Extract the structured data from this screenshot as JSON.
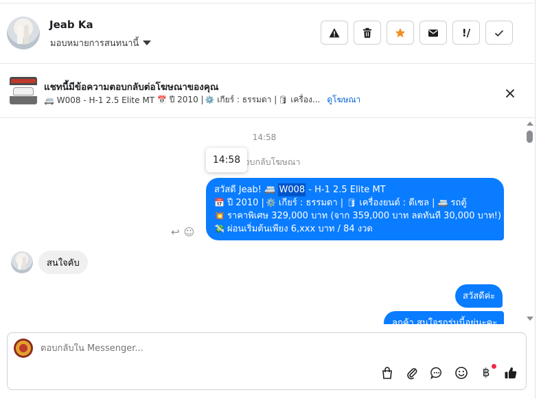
{
  "header": {
    "name": "Jeab Ka",
    "assign_label": "มอบหมายการสนทนานี้",
    "actions": [
      "warning-icon",
      "trash-icon",
      "star-icon",
      "mail-icon",
      "follow-up-icon",
      "check-icon"
    ],
    "star_color": "#f28c28"
  },
  "ad": {
    "title": "แชทนี้มีข้อความตอบกลับต่อโฆษณาของคุณ",
    "subtitle_prefix": "🚐 W008 - H-1 2.5 Elite MT",
    "subtitle_year": "ปี 2010 |",
    "subtitle_rest": "เกียร์ : ธรรมดา |",
    "subtitle_trunc": "เครื่อง...",
    "link": "ดูโฆษณา"
  },
  "chat": {
    "timestamp": "14:58",
    "tooltip_time": "14:58",
    "reply_note": "อบกลับโฆษณา",
    "ad_message": {
      "l1_a": "สวัสดี Jeab! 🚐 ",
      "l1_hl": "W008",
      "l1_b": " - H-1 2.5 Elite MT",
      "l2": "ปี 2010 |",
      "l2_b": "เกียร์ : ธรรมดา |",
      "l2_c": "เครื่องยนต์ : ดีเซล |",
      "l2_d": "รถตู้",
      "l3": "ราคาพิเศษ 329,000 บาท (จาก 359,000 บาท ลดทันที 30,000 บาท!)",
      "l4": "ผ่อนเริ่มต้นเพียง 6,xxx บาท / 84 งวด"
    },
    "incoming_1": "สนใจคับ",
    "outgoing_1": "สวัสดีค่ะ",
    "outgoing_2": "ลูกค้า สนใจรถรุ่นนี้อยู่นะคะ",
    "accent": "#0a7cff"
  },
  "composer": {
    "placeholder": "ตอบกลับใน Messenger...",
    "tools": [
      "bag-icon",
      "paperclip-icon",
      "chat-bubble-icon",
      "emoji-icon",
      "baht-icon",
      "thumbs-up-icon"
    ],
    "baht_symbol": "฿"
  }
}
